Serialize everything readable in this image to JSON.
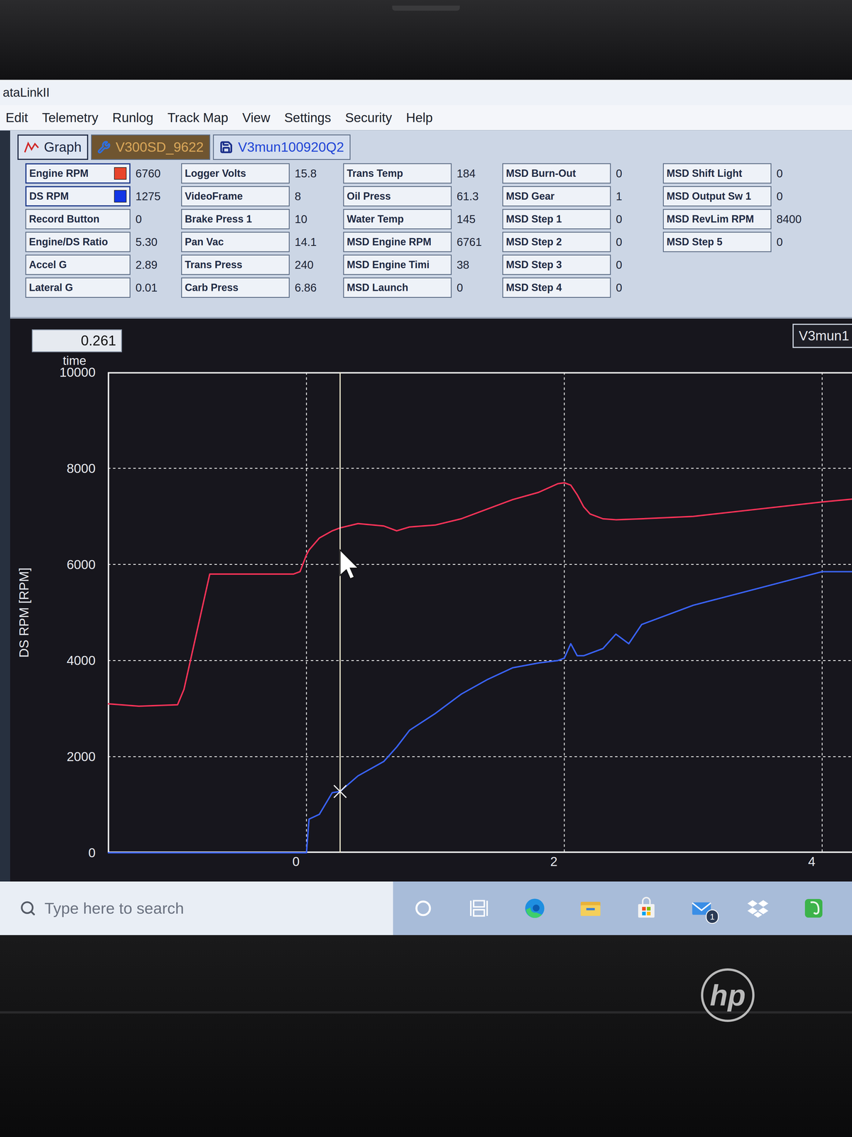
{
  "window": {
    "title": "ataLinkII"
  },
  "menu": [
    "Edit",
    "Telemetry",
    "Runlog",
    "Track Map",
    "View",
    "Settings",
    "Security",
    "Help"
  ],
  "tabs": [
    {
      "label": "Graph",
      "kind": "graph",
      "selected": true
    },
    {
      "label": "V300SD_9622",
      "kind": "config",
      "selected": false
    },
    {
      "label": "V3mun100920Q2",
      "kind": "run",
      "selected": false
    }
  ],
  "readout_columns": [
    {
      "items": [
        {
          "label": "Engine RPM",
          "value": "6760",
          "color": "#e8452c"
        },
        {
          "label": "DS RPM",
          "value": "1275",
          "color": "#1236e6"
        },
        {
          "label": "Record Button",
          "value": "0"
        },
        {
          "label": "Engine/DS Ratio",
          "value": "5.30"
        },
        {
          "label": "Accel G",
          "value": "2.89"
        },
        {
          "label": "Lateral G",
          "value": "0.01"
        }
      ]
    },
    {
      "items": [
        {
          "label": "Logger Volts",
          "value": "15.8"
        },
        {
          "label": "VideoFrame",
          "value": "8"
        },
        {
          "label": "Brake Press 1",
          "value": "10"
        },
        {
          "label": "Pan Vac",
          "value": "14.1"
        },
        {
          "label": "Trans Press",
          "value": "240"
        },
        {
          "label": "Carb Press",
          "value": "6.86"
        }
      ]
    },
    {
      "items": [
        {
          "label": "Trans Temp",
          "value": "184"
        },
        {
          "label": "Oil Press",
          "value": "61.3"
        },
        {
          "label": "Water Temp",
          "value": "145"
        },
        {
          "label": "MSD Engine RPM",
          "value": "6761"
        },
        {
          "label": "MSD Engine Timi",
          "value": "38"
        },
        {
          "label": "MSD Launch",
          "value": "0"
        }
      ]
    },
    {
      "items": [
        {
          "label": "MSD Burn-Out",
          "value": "0"
        },
        {
          "label": "MSD Gear",
          "value": "1"
        },
        {
          "label": "MSD Step 1",
          "value": "0"
        },
        {
          "label": "MSD Step 2",
          "value": "0"
        },
        {
          "label": "MSD Step 3",
          "value": "0"
        },
        {
          "label": "MSD Step 4",
          "value": "0"
        }
      ]
    },
    {
      "items": [
        {
          "label": "MSD Shift Light",
          "value": "0"
        },
        {
          "label": "MSD Output Sw 1",
          "value": "0"
        },
        {
          "label": "MSD RevLim RPM",
          "value": "8400"
        },
        {
          "label": "MSD Step 5",
          "value": "0"
        }
      ]
    }
  ],
  "chart": {
    "cursor_time": "0.261",
    "x_title": "time",
    "y_title": "DS RPM [RPM]",
    "y_ticks": [
      "0",
      "2000",
      "4000",
      "6000",
      "8000",
      "10000"
    ],
    "x_ticks": [
      "0",
      "2",
      "4"
    ],
    "legend": "V3mun1",
    "time": [
      -1.54,
      -1.3,
      -1.0,
      -0.95,
      -0.85,
      -0.75,
      -0.5,
      -0.1,
      -0.05,
      0,
      0.02,
      0.1,
      0.2,
      0.26,
      0.4,
      0.6,
      0.7,
      0.8,
      1.0,
      1.2,
      1.4,
      1.6,
      1.8,
      1.95,
      2.0,
      2.05,
      2.1,
      2.15,
      2.2,
      2.3,
      2.4,
      2.5,
      2.6,
      3.0,
      3.5,
      4.0,
      4.31
    ],
    "series": [
      {
        "name": "Engine RPM",
        "color": "#ff3358",
        "values": [
          3100,
          3050,
          3080,
          3400,
          4600,
          5800,
          5800,
          5800,
          5850,
          6200,
          6300,
          6550,
          6700,
          6760,
          6850,
          6800,
          6700,
          6780,
          6820,
          6950,
          7150,
          7350,
          7500,
          7680,
          7700,
          7650,
          7450,
          7200,
          7050,
          6950,
          6930,
          6940,
          6950,
          7000,
          7150,
          7300,
          7380
        ]
      },
      {
        "name": "DS RPM",
        "color": "#3a63ff",
        "values": [
          0,
          0,
          0,
          0,
          0,
          0,
          0,
          0,
          0,
          0,
          700,
          800,
          1250,
          1275,
          1600,
          1900,
          2200,
          2550,
          2900,
          3300,
          3600,
          3850,
          3950,
          4000,
          4050,
          4350,
          4100,
          4100,
          4150,
          4250,
          4550,
          4350,
          4750,
          5150,
          5500,
          5850,
          5850
        ]
      }
    ],
    "marker_value": "1275"
  },
  "taskbar": {
    "search": {
      "placeholder": "Type here to search"
    },
    "apps": [
      {
        "kind": "cortana",
        "badge": ""
      },
      {
        "kind": "taskview",
        "badge": ""
      },
      {
        "kind": "edge",
        "badge": ""
      },
      {
        "kind": "explorer",
        "badge": ""
      },
      {
        "kind": "store",
        "badge": ""
      },
      {
        "kind": "mail",
        "badge": "1"
      },
      {
        "kind": "dropbox",
        "badge": ""
      },
      {
        "kind": "evernote",
        "badge": ""
      }
    ]
  },
  "bezel": {
    "logo": "hp"
  }
}
